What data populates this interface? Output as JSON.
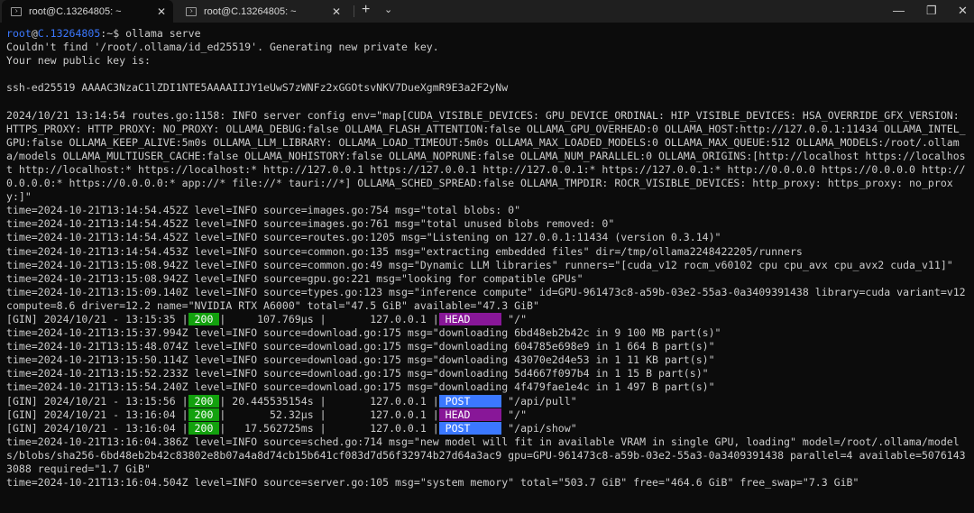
{
  "tabs": [
    {
      "title": "root@C.13264805: ~",
      "close": "✕"
    },
    {
      "title": "root@C.13264805: ~",
      "close": "✕"
    }
  ],
  "controls": {
    "new_tab": "+",
    "dropdown": "⌄",
    "minimize": "—",
    "maximize": "❐",
    "close": "✕"
  },
  "prompt": {
    "user": "root",
    "at": "@",
    "host": "C.13264805",
    "path": ":~$ ",
    "command": "ollama serve"
  },
  "lines": [
    "Couldn't find '/root/.ollama/id_ed25519'. Generating new private key.",
    "Your new public key is:",
    "",
    "ssh-ed25519 AAAAC3NzaC1lZDI1NTE5AAAAIIJY1eUwS7zWNFz2xGGOtsvNKV7DueXgmR9E3a2F2yNw",
    "",
    "2024/10/21 13:14:54 routes.go:1158: INFO server config env=\"map[CUDA_VISIBLE_DEVICES: GPU_DEVICE_ORDINAL: HIP_VISIBLE_DEVICES: HSA_OVERRIDE_GFX_VERSION: HTTPS_PROXY: HTTP_PROXY: NO_PROXY: OLLAMA_DEBUG:false OLLAMA_FLASH_ATTENTION:false OLLAMA_GPU_OVERHEAD:0 OLLAMA_HOST:http://127.0.0.1:11434 OLLAMA_INTEL_GPU:false OLLAMA_KEEP_ALIVE:5m0s OLLAMA_LLM_LIBRARY: OLLAMA_LOAD_TIMEOUT:5m0s OLLAMA_MAX_LOADED_MODELS:0 OLLAMA_MAX_QUEUE:512 OLLAMA_MODELS:/root/.ollama/models OLLAMA_MULTIUSER_CACHE:false OLLAMA_NOHISTORY:false OLLAMA_NOPRUNE:false OLLAMA_NUM_PARALLEL:0 OLLAMA_ORIGINS:[http://localhost https://localhost http://localhost:* https://localhost:* http://127.0.0.1 https://127.0.0.1 http://127.0.0.1:* https://127.0.0.1:* http://0.0.0.0 https://0.0.0.0 http://0.0.0.0:* https://0.0.0.0:* app://* file://* tauri://*] OLLAMA_SCHED_SPREAD:false OLLAMA_TMPDIR: ROCR_VISIBLE_DEVICES: http_proxy: https_proxy: no_proxy:]\"",
    "time=2024-10-21T13:14:54.452Z level=INFO source=images.go:754 msg=\"total blobs: 0\"",
    "time=2024-10-21T13:14:54.452Z level=INFO source=images.go:761 msg=\"total unused blobs removed: 0\"",
    "time=2024-10-21T13:14:54.452Z level=INFO source=routes.go:1205 msg=\"Listening on 127.0.0.1:11434 (version 0.3.14)\"",
    "time=2024-10-21T13:14:54.453Z level=INFO source=common.go:135 msg=\"extracting embedded files\" dir=/tmp/ollama2248422205/runners",
    "time=2024-10-21T13:15:08.942Z level=INFO source=common.go:49 msg=\"Dynamic LLM libraries\" runners=\"[cuda_v12 rocm_v60102 cpu cpu_avx cpu_avx2 cuda_v11]\"",
    "time=2024-10-21T13:15:08.942Z level=INFO source=gpu.go:221 msg=\"looking for compatible GPUs\"",
    "time=2024-10-21T13:15:09.140Z level=INFO source=types.go:123 msg=\"inference compute\" id=GPU-961473c8-a59b-03e2-55a3-0a3409391438 library=cuda variant=v12 compute=8.6 driver=12.2 name=\"NVIDIA RTX A6000\" total=\"47.5 GiB\" available=\"47.3 GiB\""
  ],
  "gin1": {
    "prefix": "[GIN] 2024/10/21 - 13:15:35 |",
    "status": " 200 ",
    "mid": "|     107.769µs |       127.0.0.1 |",
    "method": " HEAD     ",
    "path": " \"/\""
  },
  "lines2": [
    "time=2024-10-21T13:15:37.994Z level=INFO source=download.go:175 msg=\"downloading 6bd48eb2b42c in 9 100 MB part(s)\"",
    "time=2024-10-21T13:15:48.074Z level=INFO source=download.go:175 msg=\"downloading 604785e698e9 in 1 664 B part(s)\"",
    "time=2024-10-21T13:15:50.114Z level=INFO source=download.go:175 msg=\"downloading 43070e2d4e53 in 1 11 KB part(s)\"",
    "time=2024-10-21T13:15:52.233Z level=INFO source=download.go:175 msg=\"downloading 5d4667f097b4 in 1 15 B part(s)\"",
    "time=2024-10-21T13:15:54.240Z level=INFO source=download.go:175 msg=\"downloading 4f479fae1e4c in 1 497 B part(s)\""
  ],
  "gin2": {
    "prefix": "[GIN] 2024/10/21 - 13:15:56 |",
    "status": " 200 ",
    "mid": "| 20.445535154s |       127.0.0.1 |",
    "method": " POST     ",
    "path": " \"/api/pull\""
  },
  "gin3": {
    "prefix": "[GIN] 2024/10/21 - 13:16:04 |",
    "status": " 200 ",
    "mid": "|       52.32µs |       127.0.0.1 |",
    "method": " HEAD     ",
    "path": " \"/\""
  },
  "gin4": {
    "prefix": "[GIN] 2024/10/21 - 13:16:04 |",
    "status": " 200 ",
    "mid": "|   17.562725ms |       127.0.0.1 |",
    "method": " POST     ",
    "path": " \"/api/show\""
  },
  "lines3": [
    "time=2024-10-21T13:16:04.386Z level=INFO source=sched.go:714 msg=\"new model will fit in available VRAM in single GPU, loading\" model=/root/.ollama/models/blobs/sha256-6bd48eb2b42c83802e8b07a4a8d74cb15b641cf083d7d56f32974b27d64a3ac9 gpu=GPU-961473c8-a59b-03e2-55a3-0a3409391438 parallel=4 available=50761433088 required=\"1.7 GiB\"",
    "time=2024-10-21T13:16:04.504Z level=INFO source=server.go:105 msg=\"system memory\" total=\"503.7 GiB\" free=\"464.6 GiB\" free_swap=\"7.3 GiB\""
  ]
}
